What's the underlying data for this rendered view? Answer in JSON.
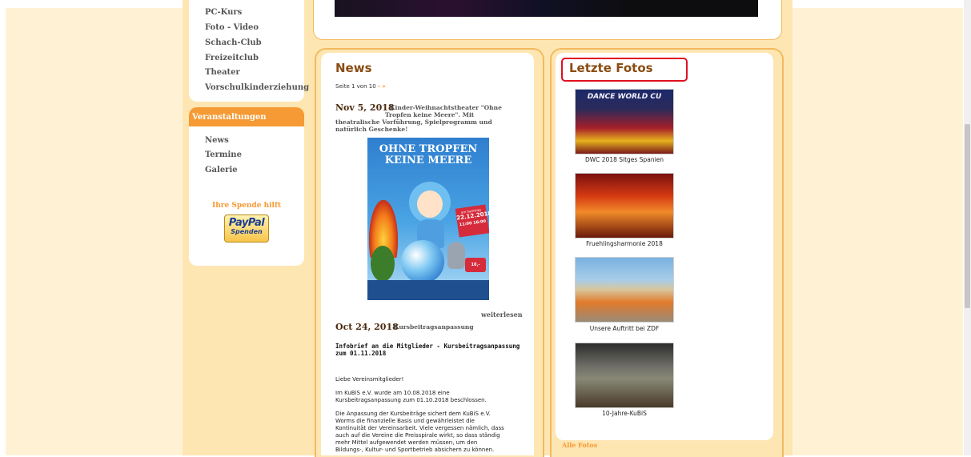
{
  "sidebar": {
    "top_links": [
      "PC-Kurs",
      "Foto - Video",
      "Schach-Club",
      "Freizeitclub",
      "Theater",
      "Vorschulkinderziehung"
    ],
    "section_header": "Veranstaltungen",
    "event_links": [
      "News",
      "Termine",
      "Galerie"
    ],
    "donate_label": "Ihre Spende hilft",
    "paypal_logo": "PayPal",
    "paypal_sub": "Spenden"
  },
  "news": {
    "title": "News",
    "pager_text": "Seite 1 von 10",
    "pager_arrows": "› »",
    "item1": {
      "date": "Nov 5, 2018",
      "headline_line1": "Kinder-Weihnachtstheater \"Ohne",
      "headline_line2": "Tropfen keine Meere\". Mit",
      "headline_line3": "theatralische Vorführung, Spielprogramm und",
      "headline_line4": "natürlich Geschenke!",
      "poster": {
        "title_line1": "OHNE TROPFEN",
        "title_line2": "KEINE MEERE",
        "date_label": "am Samstag",
        "date": "22.12.2018",
        "times": "11:00  16:00",
        "price": "10,-"
      },
      "read_more": "weiterlesen"
    },
    "item2": {
      "date": "Oct 24, 2018",
      "headline": "Kursbeitragsanpassung",
      "bold_line1": "Infobrief an die Mitglieder - Kursbeitragsanpassung",
      "bold_line2": "zum 01.11.2018",
      "para1": "Liebe Vereinsmitglieder!",
      "para2_line1": "Im KuBiS e.V.  wurde am 10.08.2018 eine",
      "para2_line2": "Kursbeitragsanpassung zum 01.10.2018 beschlossen.",
      "para3_line1": "Die Anpassung der Kursbeiträge sichert dem KuBiS e.V.",
      "para3_line2": "Worms die finanzielle Basis und gewährleistet die",
      "para3_line3": "Kontinuität der Vereinsarbeit. Viele vergessen nämlich, dass",
      "para3_line4": "auch auf die Vereine die Preisspirale wirkt, so dass ständig",
      "para3_line5": "mehr Mittel aufgewendet werden müssen, um den",
      "para3_line6": "Bildungs-, Kultur- und Sportbetrieb absichern zu können."
    }
  },
  "photos": {
    "title": "Letzte Fotos",
    "items": [
      {
        "caption": "DWC 2018 Sitges Spanien",
        "banner": "DANCE WORLD CU"
      },
      {
        "caption": "Fruehlingsharmonie 2018"
      },
      {
        "caption": "Unsere Auftritt bei ZDF"
      },
      {
        "caption": "10-Jahre-KuBiS"
      }
    ],
    "all_link": "Alle Fotos"
  },
  "colors": {
    "accent_orange": "#f59a34",
    "title_brown": "#8a4c12",
    "highlight_red": "#e0101e"
  }
}
